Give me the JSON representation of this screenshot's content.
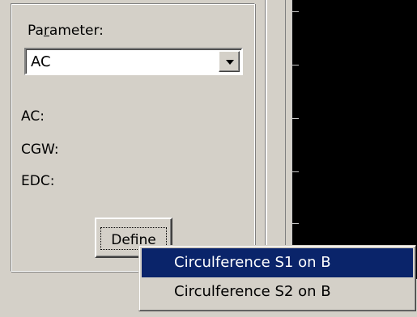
{
  "panel": {
    "parameter_label_pre": "Pa",
    "parameter_label_mnemonic": "r",
    "parameter_label_post": "ameter:",
    "selected_parameter": "AC",
    "fields": {
      "ac": "AC:",
      "cgw": "CGW:",
      "edc": "EDC:"
    },
    "define_label": "Define"
  },
  "context_menu": {
    "items": [
      {
        "label": "Circulference S1 on B",
        "selected": true
      },
      {
        "label": "Circulference S2 on B",
        "selected": false
      }
    ]
  },
  "colors": {
    "face": "#d4d0c8",
    "highlight": "#0a246a",
    "plot_bg": "#000000"
  }
}
